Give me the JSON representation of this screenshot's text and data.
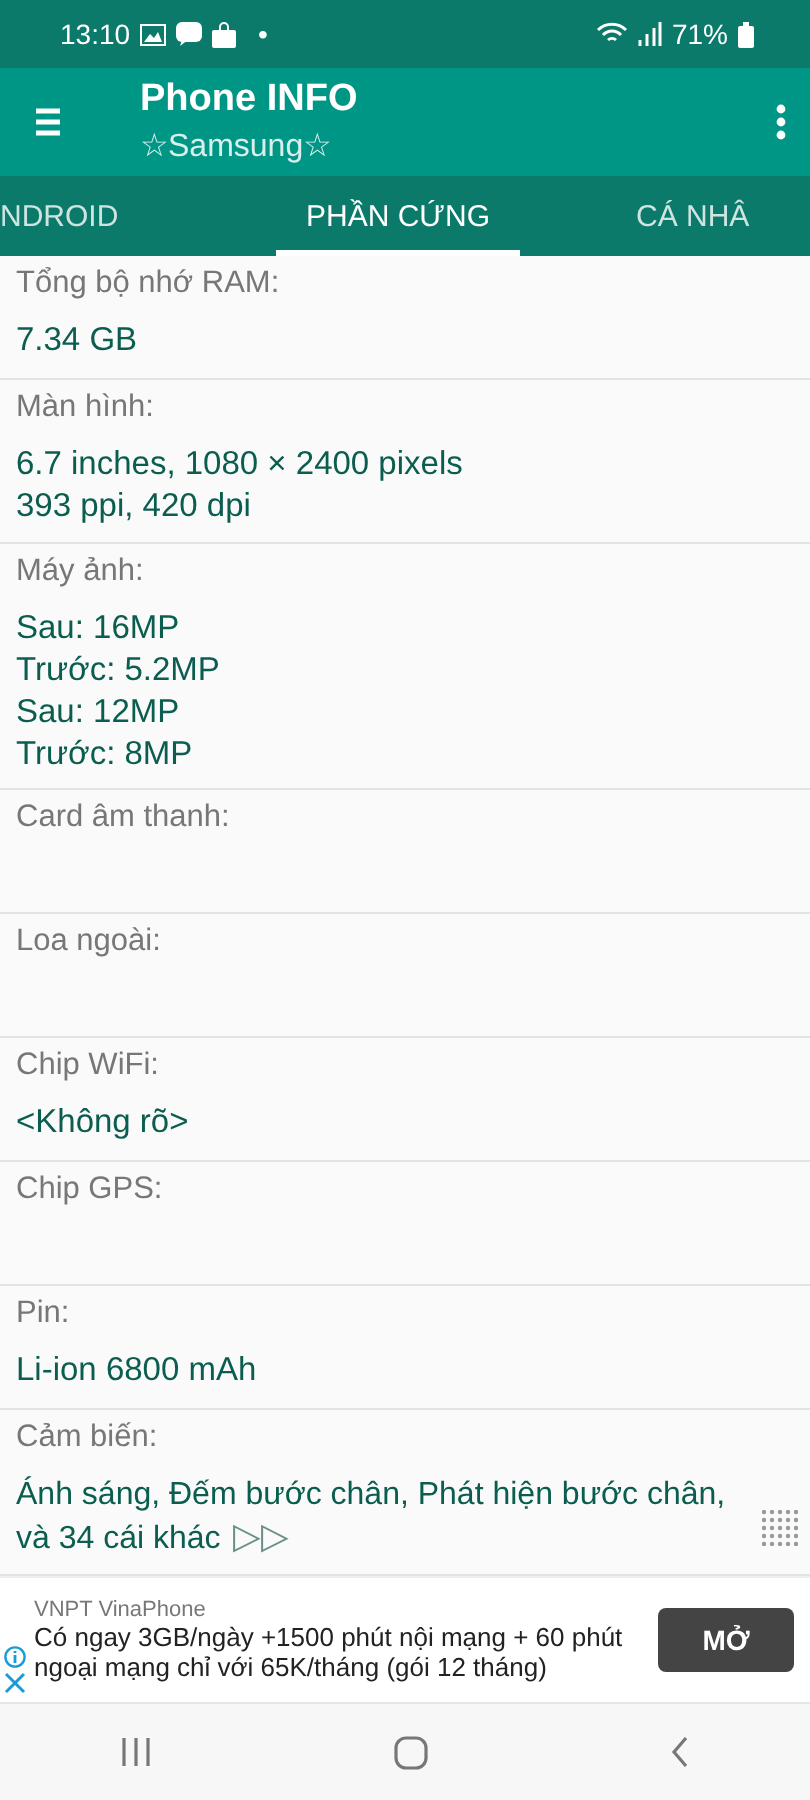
{
  "status_bar": {
    "time": "13:10",
    "dot": "•",
    "battery": "71%"
  },
  "app_bar": {
    "title": "Phone INFO",
    "subtitle": "☆Samsung☆"
  },
  "tabs": [
    {
      "label": "NDROID",
      "selected": false
    },
    {
      "label": "PHẦN CỨNG",
      "selected": true
    },
    {
      "label": "CÁ NHÂ",
      "selected": false
    }
  ],
  "rows": [
    {
      "label": "Tổng bộ nhớ RAM:",
      "lines": [
        "7.34 GB"
      ]
    },
    {
      "label": "Màn hình:",
      "lines": [
        "6.7 inches, 1080 × 2400 pixels",
        "393 ppi, 420 dpi"
      ]
    },
    {
      "label": "Máy ảnh:",
      "lines": [
        "Sau: 16MP",
        "Trước: 5.2MP",
        "Sau: 12MP",
        "Trước: 8MP"
      ]
    },
    {
      "label": "Card âm thanh:",
      "lines": []
    },
    {
      "label": "Loa ngoài:",
      "lines": []
    },
    {
      "label": "Chip WiFi:",
      "lines": [
        "<Không rõ>"
      ]
    },
    {
      "label": "Chip GPS:",
      "lines": []
    },
    {
      "label": "Pin:",
      "lines": [
        "Li-ion 6800 mAh"
      ]
    },
    {
      "label": "Cảm biến:",
      "lines": [
        "Ánh sáng, Đếm bước chân, Phát hiện bước chân, và 34 cái khác"
      ],
      "more": "▷▷"
    }
  ],
  "ad": {
    "advertiser": "VNPT VinaPhone",
    "text": "Có ngay 3GB/ngày +1500 phút nội mạng + 60 phút ngoại mạng chỉ với 65K/tháng (gói 12 tháng)",
    "button": "MỞ"
  }
}
